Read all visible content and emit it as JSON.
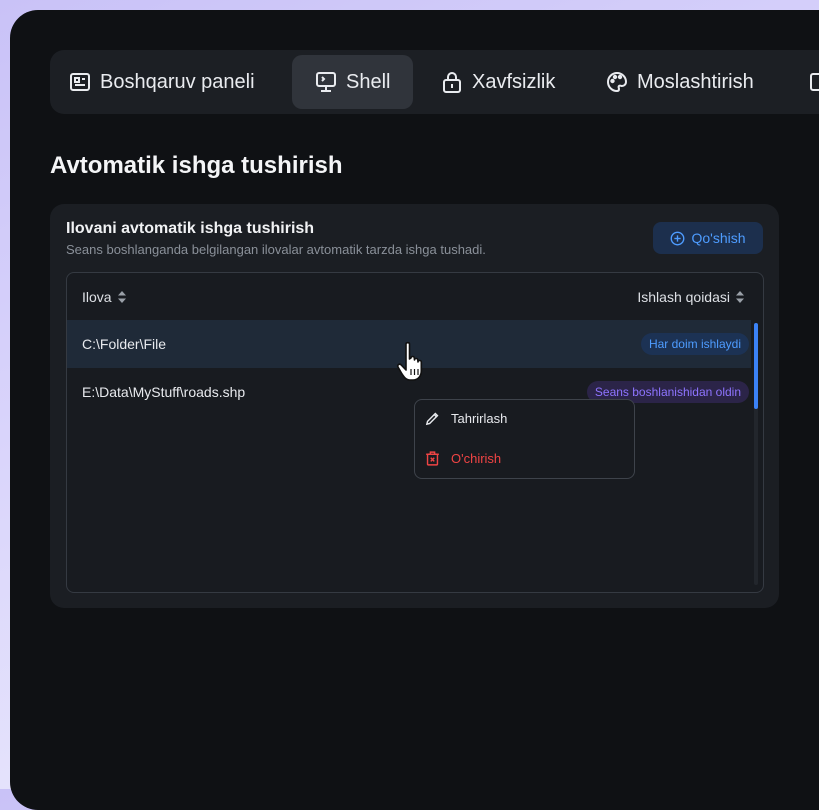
{
  "tabs": [
    {
      "label": "Boshqaruv paneli",
      "icon": "dashboard-icon",
      "active": false
    },
    {
      "label": "Shell",
      "icon": "monitor-icon",
      "active": true
    },
    {
      "label": "Xavfsizlik",
      "icon": "lock-icon",
      "active": false
    },
    {
      "label": "Moslashtirish",
      "icon": "palette-icon",
      "active": false
    }
  ],
  "page": {
    "title": "Avtomatik ishga tushirish"
  },
  "card": {
    "title": "Ilovani avtomatik ishga tushirish",
    "subtitle": "Seans boshlanganda belgilangan ilovalar avtomatik tarzda ishga tushadi.",
    "add_label": "Qo'shish"
  },
  "table": {
    "columns": [
      "Ilova",
      "Ishlash qoidasi"
    ],
    "rows": [
      {
        "path": "C:\\Folder\\File",
        "rule": "Har doim ishlaydi",
        "rule_color": "#4e9cff"
      },
      {
        "path": "E:\\Data\\MyStuff\\roads.shp",
        "rule": "Seans boshlanishidan oldin",
        "rule_color": "#8e74ff"
      }
    ]
  },
  "context_menu": {
    "edit_label": "Tahrirlash",
    "delete_label": "O'chirish"
  },
  "colors": {
    "accent": "#3b82f6",
    "danger": "#ef4444",
    "background": "#0f1114"
  }
}
